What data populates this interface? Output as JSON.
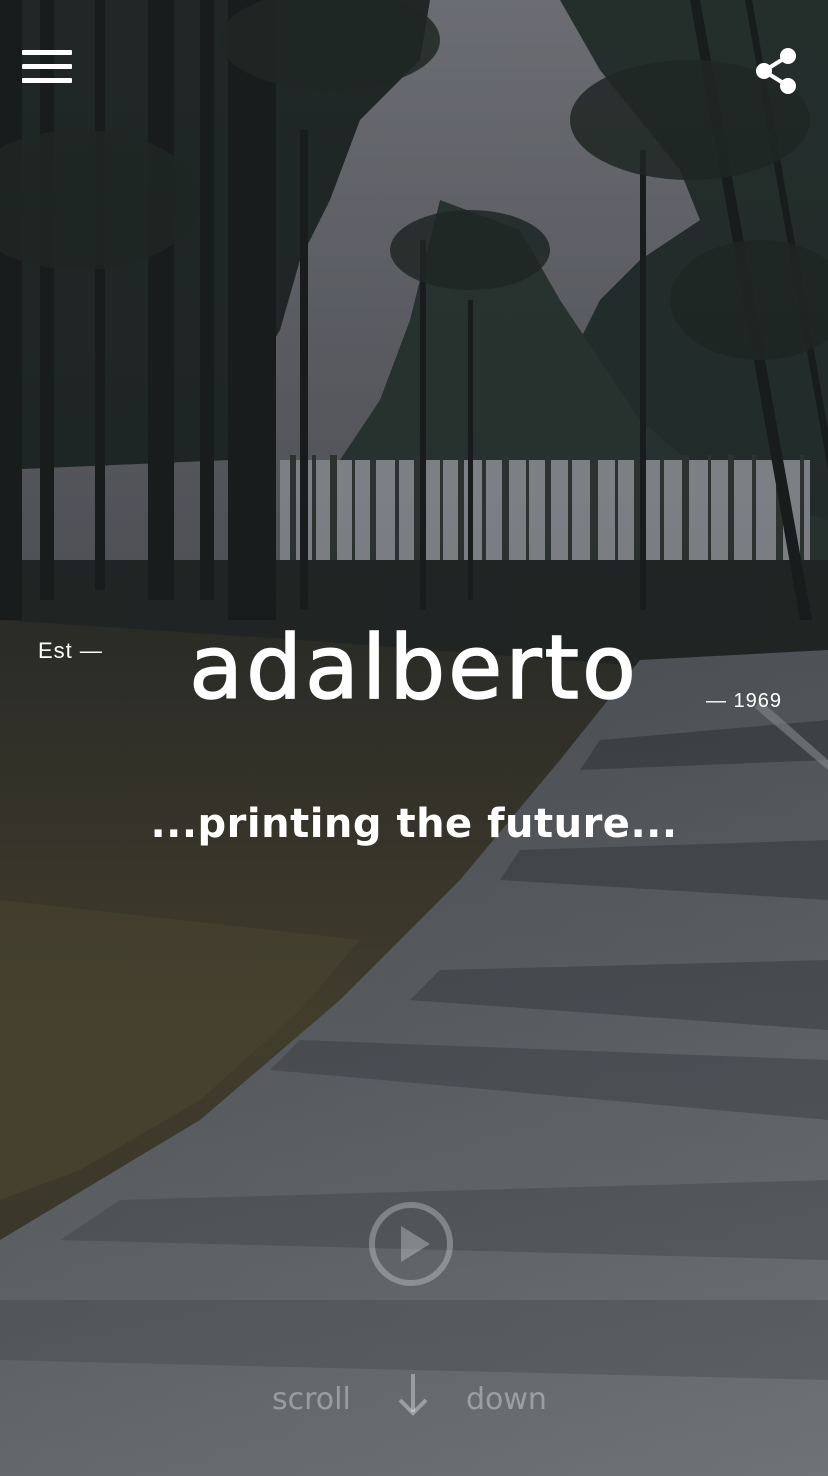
{
  "header": {
    "menu_icon": "hamburger-menu-icon",
    "share_icon": "share-icon"
  },
  "hero": {
    "est_label": "Est —",
    "brand": "adalberto",
    "year_label": "— 1969",
    "tagline": "...printing the future..."
  },
  "video": {
    "play_icon": "play-icon"
  },
  "scroll_hint": {
    "left_word": "scroll",
    "right_word": "down",
    "arrow_icon": "arrow-down-icon"
  },
  "colors": {
    "text": "#ffffff",
    "overlay": "#1e2228",
    "muted_text": "rgba(255,255,255,0.35)"
  }
}
